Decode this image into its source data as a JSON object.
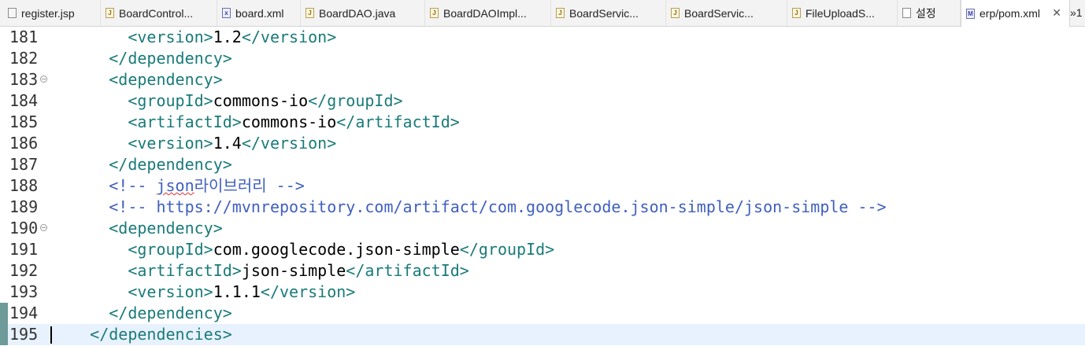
{
  "tabs": [
    {
      "label": "register.jsp",
      "icon": "jsp-file-icon"
    },
    {
      "label": "BoardControl...",
      "icon": "java-file-icon"
    },
    {
      "label": "board.xml",
      "icon": "xml-file-icon"
    },
    {
      "label": "BoardDAO.java",
      "icon": "java-file-icon"
    },
    {
      "label": "BoardDAOImpl...",
      "icon": "java-file-icon"
    },
    {
      "label": "BoardServic...",
      "icon": "java-file-icon"
    },
    {
      "label": "BoardServic...",
      "icon": "java-file-icon"
    },
    {
      "label": "FileUploadS...",
      "icon": "java-file-icon"
    },
    {
      "label": "설정",
      "icon": "text-file-icon"
    },
    {
      "label": "erp/pom.xml",
      "icon": "maven-pom-icon",
      "active": true
    }
  ],
  "tab_close": "✕",
  "tab_overflow": "»1",
  "colors": {
    "tag": "#1a7a7a",
    "text": "#000000",
    "comment": "#3f5fbf",
    "current_line": "#e8f2fe",
    "gutter_marker": "#6e9a9a"
  },
  "lines": [
    {
      "num": "181",
      "indent": "        ",
      "open": "<version>",
      "text": "1.2",
      "close": "</version>"
    },
    {
      "num": "182",
      "indent": "      ",
      "tag": "</dependency>"
    },
    {
      "num": "183",
      "indent": "      ",
      "tag": "<dependency>",
      "fold": true
    },
    {
      "num": "184",
      "indent": "        ",
      "open": "<groupId>",
      "text": "commons-io",
      "close": "</groupId>"
    },
    {
      "num": "185",
      "indent": "        ",
      "open": "<artifactId>",
      "text": "commons-io",
      "close": "</artifactId>"
    },
    {
      "num": "186",
      "indent": "        ",
      "open": "<version>",
      "text": "1.4",
      "close": "</version>"
    },
    {
      "num": "187",
      "indent": "      ",
      "tag": "</dependency>"
    },
    {
      "num": "188",
      "indent": "      ",
      "comment_start": "<!-- ",
      "comment_spell": "json",
      "comment_rest": "라이브러리 -->"
    },
    {
      "num": "189",
      "indent": "      ",
      "comment": "<!-- https://mvnrepository.com/artifact/com.googlecode.json-simple/json-simple -->"
    },
    {
      "num": "190",
      "indent": "      ",
      "tag": "<dependency>",
      "fold": true
    },
    {
      "num": "191",
      "indent": "        ",
      "open": "<groupId>",
      "text": "com.googlecode.json-simple",
      "close": "</groupId>"
    },
    {
      "num": "192",
      "indent": "        ",
      "open": "<artifactId>",
      "text": "json-simple",
      "close": "</artifactId>"
    },
    {
      "num": "193",
      "indent": "        ",
      "open": "<version>",
      "text": "1.1.1",
      "close": "</version>"
    },
    {
      "num": "194",
      "indent": "      ",
      "tag": "</dependency>",
      "marker": true
    },
    {
      "num": "195",
      "indent": "    ",
      "tag": "</dependencies>",
      "marker": true,
      "current": true
    }
  ]
}
